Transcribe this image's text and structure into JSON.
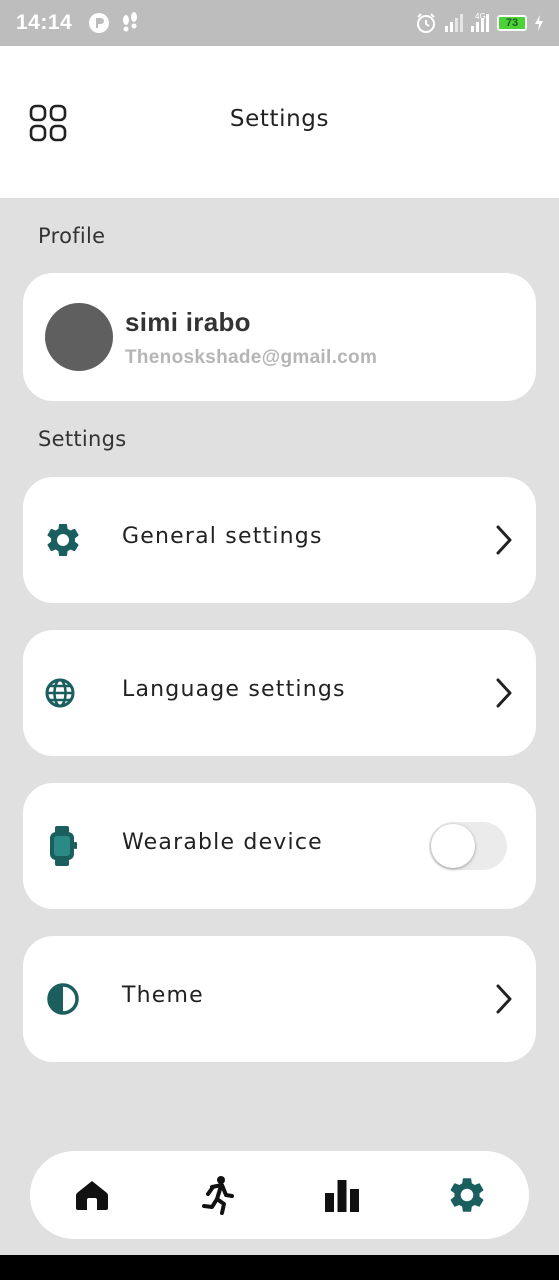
{
  "status_bar": {
    "time": "14:14",
    "network": "4G",
    "battery": "73"
  },
  "header": {
    "title": "Settings",
    "menu_icon": "grid-icon"
  },
  "profile": {
    "section_label": "Profile",
    "name": "simi irabo",
    "email": "Thenoskshade@gmail.com"
  },
  "settings": {
    "section_label": "Settings",
    "items": [
      {
        "label": "General settings",
        "icon": "gear-icon",
        "control": "chevron"
      },
      {
        "label": "Language settings",
        "icon": "globe-icon",
        "control": "chevron"
      },
      {
        "label": "Wearable device",
        "icon": "watch-icon",
        "control": "toggle",
        "toggle_on": false
      },
      {
        "label": "Theme",
        "icon": "contrast-icon",
        "control": "chevron"
      }
    ]
  },
  "bottom_nav": {
    "items": [
      {
        "icon": "home-icon",
        "active": false
      },
      {
        "icon": "running-icon",
        "active": false
      },
      {
        "icon": "bar-chart-icon",
        "active": false
      },
      {
        "icon": "gear-icon",
        "active": true
      }
    ]
  },
  "colors": {
    "accent": "#1b5e5e",
    "background": "#e0e0e0",
    "card": "#ffffff",
    "status_bar": "#bdbdbd"
  }
}
